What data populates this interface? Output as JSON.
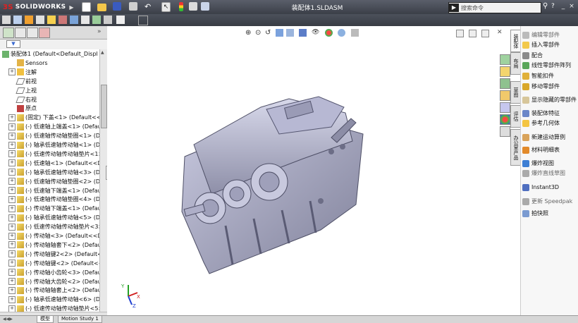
{
  "app": {
    "logo_text": "SOLIDWORKS",
    "logo_prefix": "3S",
    "document_title": "装配体1.SLDASM",
    "search_placeholder": "搜索命令",
    "help_label": "?",
    "window_buttons": [
      "_",
      "□",
      "×"
    ]
  },
  "feature_panel": {
    "filter_label": "▼",
    "root": "装配体1  (Default<Default_Displ",
    "items": [
      {
        "label": "Sensors",
        "icon": "sensors-icon",
        "expandable": false
      },
      {
        "label": "注解",
        "icon": "annotations-icon",
        "expandable": true
      },
      {
        "label": "前视",
        "icon": "plane-icon",
        "expandable": false
      },
      {
        "label": "上视",
        "icon": "plane-icon",
        "expandable": false
      },
      {
        "label": "右视",
        "icon": "plane-icon",
        "expandable": false
      },
      {
        "label": "原点",
        "icon": "origin-icon",
        "expandable": false
      },
      {
        "label": "(固定) 下盖<1> (Default<<D",
        "icon": "part-icon",
        "expandable": true
      },
      {
        "label": "(-) 低速轴上端盖<1> (Default",
        "icon": "part-icon",
        "expandable": true
      },
      {
        "label": "(-) 低速轴传动轴垫圈<1> (Defa",
        "icon": "part-icon",
        "expandable": true
      },
      {
        "label": "(-) 轴承低速轴传动轴<1> (De",
        "icon": "part-icon",
        "expandable": true
      },
      {
        "label": "(-) 低速传动轴传动轴垫片<1> (De",
        "icon": "part-icon",
        "expandable": true
      },
      {
        "label": "(-) 低速轴<1> (Default<<De",
        "icon": "part-icon",
        "expandable": true
      },
      {
        "label": "(-) 轴承低速轴传动轴<3> (De",
        "icon": "part-icon",
        "expandable": true
      },
      {
        "label": "(-) 低速轴传动轴垫圈<2> (De",
        "icon": "part-icon",
        "expandable": true
      },
      {
        "label": "(-) 低速轴下端盖<1> (Default",
        "icon": "part-icon",
        "expandable": true
      },
      {
        "label": "(-) 低速轴传动轴垫圈<4> (De",
        "icon": "part-icon",
        "expandable": true
      },
      {
        "label": "(-) 传动轴下端盖<1> (Default",
        "icon": "part-icon",
        "expandable": true
      },
      {
        "label": "(-) 轴承低速轴传动轴<5> (De",
        "icon": "part-icon",
        "expandable": true
      },
      {
        "label": "(-) 低速传动轴传动轴垫片<3> (De",
        "icon": "part-icon",
        "expandable": true
      },
      {
        "label": "(-) 传动轴<3> (Default<<De",
        "icon": "part-icon",
        "expandable": true
      },
      {
        "label": "(-) 传动轴轴套下<2> (Default",
        "icon": "part-icon",
        "expandable": true
      },
      {
        "label": "(-) 传动轴键2<2> (Default<<",
        "icon": "part-icon",
        "expandable": true
      },
      {
        "label": "(-) 传动轴键<2> (Default<<D",
        "icon": "part-icon",
        "expandable": true
      },
      {
        "label": "(-) 传动轴小齿轮<3> (Default",
        "icon": "part-icon",
        "expandable": true
      },
      {
        "label": "(-) 传动轴大齿轮<2> (Default",
        "icon": "part-icon",
        "expandable": true
      },
      {
        "label": "(-) 传动轴轴套上<2> (Default",
        "icon": "part-icon",
        "expandable": true
      },
      {
        "label": "(-) 轴承低速轴传动轴<6> (De",
        "icon": "part-icon",
        "expandable": true
      },
      {
        "label": "(-) 低速传动轴传动轴垫片<5> (De",
        "icon": "part-icon",
        "expandable": true
      }
    ]
  },
  "bottom_tabs": [
    "模型",
    "Motion Study 1"
  ],
  "task_pane_tabs": [
    "装配体",
    "布局",
    "草图",
    "评估",
    "办公室产品"
  ],
  "commands": [
    {
      "label": "编辑零部件",
      "dim": true,
      "icon": "edit-component-icon"
    },
    {
      "label": "插入零部件",
      "dim": false,
      "icon": "insert-component-icon"
    },
    {
      "label": "配合",
      "dim": false,
      "icon": "mate-icon"
    },
    {
      "label": "线性零部件阵列",
      "dim": false,
      "icon": "linear-pattern-icon"
    },
    {
      "label": "智能扣件",
      "dim": false,
      "icon": "smart-fastener-icon"
    },
    {
      "label": "移动零部件",
      "dim": false,
      "icon": "move-component-icon"
    },
    {
      "label": "显示隐藏的零部件",
      "dim": false,
      "icon": "show-hidden-icon"
    },
    {
      "label": "装配体特征",
      "dim": false,
      "icon": "assembly-feature-icon"
    },
    {
      "label": "参考几何体",
      "dim": false,
      "icon": "reference-geometry-icon"
    },
    {
      "label": "新建运动算例",
      "dim": false,
      "icon": "motion-study-icon"
    },
    {
      "label": "材料明细表",
      "dim": false,
      "icon": "bom-icon"
    },
    {
      "label": "爆炸视图",
      "dim": false,
      "icon": "exploded-view-icon"
    },
    {
      "label": "爆炸直线草图",
      "dim": true,
      "icon": "explode-line-icon"
    },
    {
      "label": "Instant3D",
      "dim": false,
      "icon": "instant3d-icon"
    },
    {
      "label": "更新 Speedpak",
      "dim": true,
      "icon": "speedpak-icon"
    },
    {
      "label": "拍快照",
      "dim": false,
      "icon": "snapshot-icon"
    }
  ],
  "colors": {
    "titlebar": "#3b3f48",
    "model": "#a8a9c8",
    "accent_red": "#e02020"
  }
}
